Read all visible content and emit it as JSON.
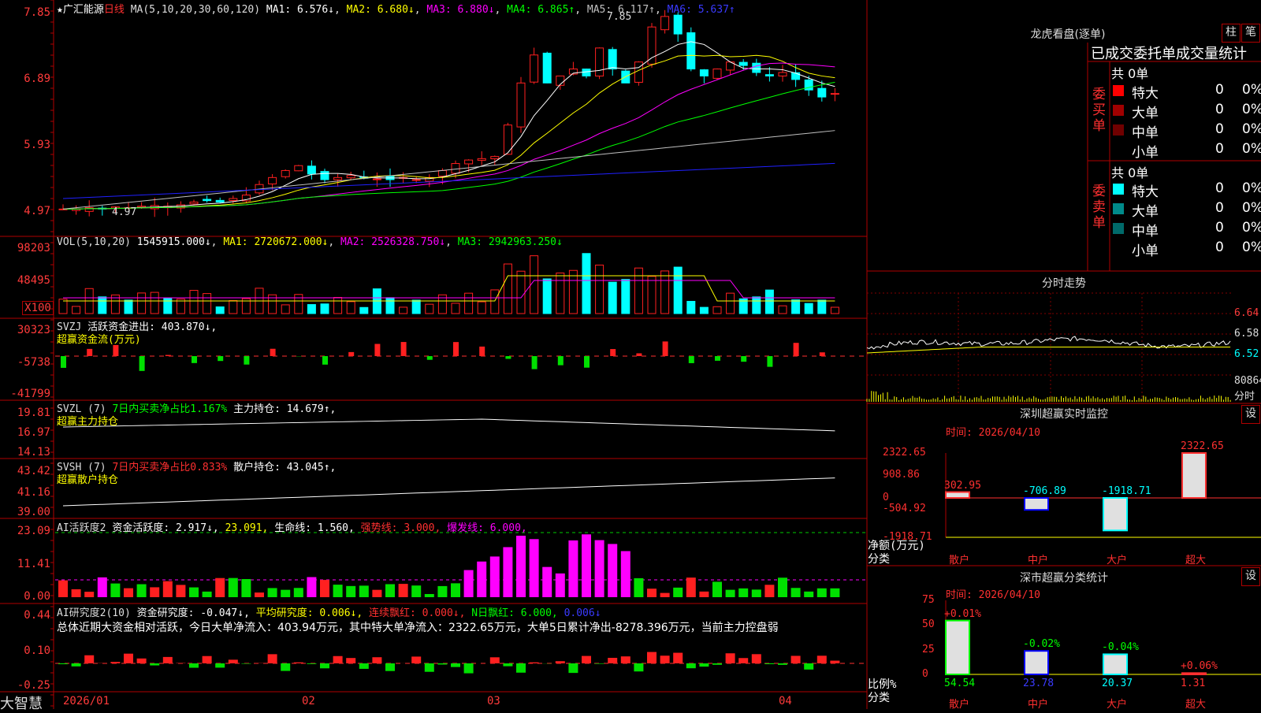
{
  "stock": {
    "name": "广汇能源",
    "period": "日线",
    "star": "★"
  },
  "price_panel": {
    "ma_text": "MA(5,10,20,30,60,120)",
    "ma1": "MA1: 6.576↓",
    "ma2": "MA2: 6.680↓",
    "ma3": "MA3: 6.880↓",
    "ma4": "MA4: 6.865↑",
    "ma5": "MA5: 6.117↑",
    "ma6": "MA6: 5.637↑",
    "y_labels": [
      "7.85",
      "6.89",
      "5.93",
      "4.97"
    ],
    "high_mark": "7.85",
    "low_mark": "4.97",
    "colors": {
      "ma1": "#ffffff",
      "ma2": "#ffff00",
      "ma3": "#ff00ff",
      "ma4": "#00ff00",
      "ma5": "#c0c0c0",
      "ma6": "#2020ff"
    }
  },
  "vol_panel": {
    "title": "VOL(5,10,20)",
    "value": "1545915.000↓",
    "ma1": "MA1: 2720672.000↓",
    "ma2": "MA2: 2526328.750↓",
    "ma3": "MA3: 2942963.250↓",
    "y_labels": [
      "98203",
      "48495"
    ],
    "unit": "X100"
  },
  "svzj_panel": {
    "title": "SVZJ",
    "text": "活跃资金进出: 403.870↓,",
    "subtitle": "超赢资金流(万元)",
    "y_labels": [
      "30323",
      "-5738",
      "-41799"
    ]
  },
  "svzl_panel": {
    "title": "SVZL (7)",
    "text1": "7日内买卖净占比1.167%",
    "text2": "主力持仓: 14.679↑,",
    "subtitle": "超赢主力持仓",
    "y_labels": [
      "19.81",
      "16.97",
      "14.13"
    ]
  },
  "svsh_panel": {
    "title": "SVSH (7)",
    "text1": "7日内买卖净占比0.833%",
    "text2": "散户持仓: 43.045↑,",
    "subtitle": "超赢散户持仓",
    "y_labels": [
      "43.42",
      "41.16",
      "39.00"
    ]
  },
  "ai_active_panel": {
    "title": "AI活跃度2",
    "t1": "资金活跃度: 2.917↓,",
    "t2": "23.091,",
    "t3": "生命线: 1.560,",
    "t4": "强势线: 3.000,",
    "t5": "爆发线: 6.000,",
    "y_labels": [
      "23.09",
      "11.41",
      "0.00"
    ]
  },
  "ai_research_panel": {
    "title": "AI研究度2(10)",
    "t1": "资金研究度: -0.047↓,",
    "t2": "平均研究度: 0.006↓,",
    "t3": "连续飘红: 0.000↓,",
    "t4": "N日飘红: 6.000,",
    "t5": "0.006↓",
    "summary": "总体近期大资金相对活跃，今日大单净流入：403.94万元，其中特大单净流入：2322.65万元，大单5日累计净出-8278.396万元，当前主力控盘弱",
    "y_labels": [
      "0.44",
      "0.10",
      "-0.25"
    ]
  },
  "x_axis": {
    "labels": [
      "2026/01",
      "02",
      "03",
      "04"
    ],
    "brand": "大智慧"
  },
  "lhb": {
    "title": "龙虎看盘(逐单)",
    "btn1": "柱",
    "btn2": "笔",
    "header": "已成交委托单成交量统计",
    "buy": {
      "side_label": "委买单",
      "total": "共 0单",
      "rows": [
        {
          "name": "特大",
          "count": "0",
          "pct": "0%",
          "color": "#ff0000"
        },
        {
          "name": "大单",
          "count": "0",
          "pct": "0%",
          "color": "#a00000"
        },
        {
          "name": "中单",
          "count": "0",
          "pct": "0%",
          "color": "#700000"
        },
        {
          "name": "小单",
          "count": "0",
          "pct": "0%",
          "color": "#000000"
        }
      ]
    },
    "sell": {
      "side_label": "委卖单",
      "total": "共 0单",
      "rows": [
        {
          "name": "特大",
          "count": "0",
          "pct": "0%",
          "color": "#00ffff"
        },
        {
          "name": "大单",
          "count": "0",
          "pct": "0%",
          "color": "#008b8b"
        },
        {
          "name": "中单",
          "count": "0",
          "pct": "0%",
          "color": "#006a6a"
        },
        {
          "name": "小单",
          "count": "0",
          "pct": "0%",
          "color": "#000000"
        }
      ]
    }
  },
  "intraday": {
    "title": "分时走势",
    "y_labels": [
      "6.64",
      "6.58",
      "6.52",
      "80864",
      "分时"
    ]
  },
  "monitor": {
    "title": "深圳超赢实时监控",
    "btn": "设",
    "time": "时间: 2026/04/10",
    "y_labels": [
      "2322.65",
      "908.86",
      "0",
      "-504.92",
      "-1918.71"
    ],
    "axis_label": "净额(万元)",
    "axis_label2": "分类",
    "categories": [
      "散户",
      "中户",
      "大户",
      "超大"
    ],
    "values": [
      302.95,
      -706.89,
      -1918.71,
      2322.65
    ],
    "value_labels": [
      "302.95",
      "-706.89",
      "-1918.71",
      "2322.65"
    ]
  },
  "classify": {
    "title": "深市超赢分类统计",
    "btn": "设",
    "time": "时间: 2026/04/10",
    "y_labels": [
      "75",
      "50",
      "25",
      "0"
    ],
    "axis_label": "比例%",
    "axis_label2": "分类",
    "categories": [
      "散户",
      "中户",
      "大户",
      "超大"
    ],
    "values": [
      54.54,
      23.78,
      20.37,
      1.31
    ],
    "value_labels": [
      "54.54",
      "23.78",
      "20.37",
      "1.31"
    ],
    "change_labels": [
      "+0.01%",
      "-0.02%",
      "-0.04%",
      "+0.06%"
    ]
  }
}
